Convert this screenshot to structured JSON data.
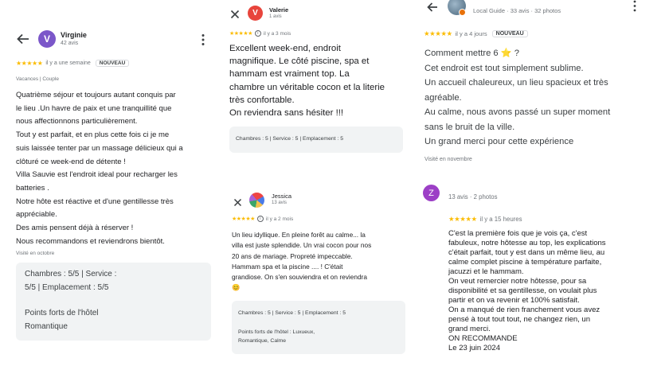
{
  "panel1": {
    "reviewer_name": "Virginie",
    "reviewer_initial": "V",
    "reviewer_meta": "42 avis",
    "stars": "★★★★★",
    "time": "il y a une semaine",
    "badge": "NOUVEAU",
    "trip": "Vacances | Couple",
    "lines": [
      "Quatrième séjour et toujours autant conquis par",
      "le lieu .Un havre de paix et une tranquillité que",
      "nous affectionnons particulièrement.",
      "Tout y est parfait, et en plus cette fois ci je me",
      "suis laissée tenter par un massage délicieux qui a",
      "clôturé ce week-end de détente !",
      "Villa Sauvie est l'endroit ideal pour recharger les",
      "batteries .",
      "Notre hôte est réactive et d'une gentillesse très",
      "appréciable.",
      "Des amis pensent déjà à réserver !",
      "Nous recommandons et reviendrons bientôt."
    ],
    "visited": "Visité en octobre",
    "ratings_line1": "Chambres : 5/5  |  Service :",
    "ratings_line2": "5/5  |  Emplacement : 5/5",
    "highlights_title": "Points forts de l'hôtel",
    "highlights_value": "Romantique"
  },
  "panel2": {
    "review1": {
      "reviewer_name": "Valerie",
      "reviewer_initial": "V",
      "reviewer_meta": "1 avis",
      "stars": "★★★★★",
      "time": "il y a 3 mois",
      "lines": [
        "Excellent week-end, endroit",
        "magnifique. Le côté piscine, spa et",
        "hammam est vraiment top. La",
        "chambre un véritable cocon et la literie",
        "très confortable.",
        "On reviendra sans hésiter !!!"
      ],
      "ratings": "Chambres : 5 | Service : 5 | Emplacement : 5"
    },
    "review2": {
      "reviewer_name": "Jessica",
      "reviewer_meta": "13 avis",
      "stars": "★★★★★",
      "time": "il y a 2 mois",
      "lines": [
        "Un lieu idyllique. En pleine forêt au calme... la",
        "villa est juste splendide. Un vrai cocon pour nos",
        "20 ans de mariage. Propreté impeccable.",
        "Hammam spa et la piscine .... ! C'était",
        "grandiose. On s'en souviendra et on reviendra",
        "😊"
      ],
      "ratings": "Chambres : 5 | Service : 5 | Emplacement : 5",
      "highlights_line1": "Points forts de l'hôtel : Luxueux,",
      "highlights_line2": "Romantique, Calme"
    }
  },
  "panel3": {
    "review1": {
      "reviewer_meta": "Local Guide · 33 avis · 32 photos",
      "stars": "★★★★★",
      "time": "il y a 4 jours",
      "badge": "NOUVEAU",
      "lines": [
        "Comment mettre 6 ⭐ ?",
        "Cet endroit est tout simplement sublime.",
        "Un accueil chaleureux, un lieu spacieux et très",
        "agréable.",
        "Au calme, nous avons passé un super moment",
        "sans le bruit de la ville.",
        "Un grand merci pour cette expérience"
      ],
      "visited": "Visité en novembre"
    },
    "review2": {
      "reviewer_initial": "Z",
      "reviewer_meta": "13 avis · 2 photos",
      "stars": "★★★★★",
      "time": "il y a 15 heures",
      "lines": [
        "C'est la première fois que je vois ça, c'est",
        "fabuleux, notre hôtesse au top, les explications",
        "c'était parfait, tout y est dans un même lieu, au",
        "calme complet piscine à température parfaite,",
        "jacuzzi et le hammam.",
        "On veut remercier notre hôtesse, pour sa",
        "disponibilité et sa gentillesse, on voulait plus",
        "partir et on va revenir et 100% satisfait.",
        "On a manqué de rien franchement vous avez",
        "pensé à tout tout tout, ne changez rien, un",
        "grand merci.",
        "ON RECOMMANDE",
        "Le 23 juin 2024"
      ]
    }
  },
  "colors": {
    "star": "#fbbc04",
    "avatar_purple": "#7b57c9",
    "avatar_red": "#e8453c",
    "avatar_z": "#9c3fc6"
  },
  "icons": [
    "back-arrow-icon",
    "more-vert-icon",
    "close-icon",
    "info-icon"
  ]
}
